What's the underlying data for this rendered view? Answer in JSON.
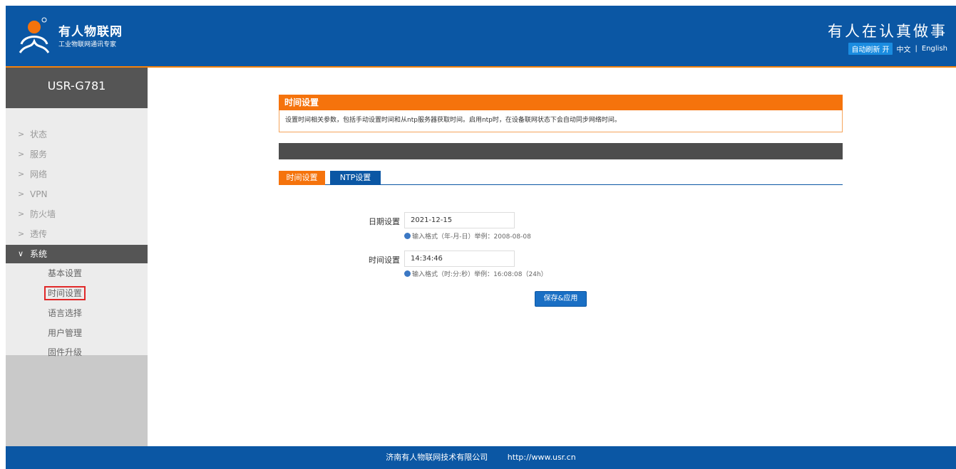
{
  "header": {
    "brand_title": "有人物联网",
    "brand_sub": "工业物联网通讯专家",
    "slogan": "有人在认真做事",
    "auto_refresh": "自动刷新 开",
    "lang_cn": "中文",
    "lang_sep": "|",
    "lang_en": "English"
  },
  "sidebar": {
    "model": "USR-G781",
    "menu": [
      {
        "label": "状态",
        "chevron": ">"
      },
      {
        "label": "服务",
        "chevron": ">"
      },
      {
        "label": "网络",
        "chevron": ">"
      },
      {
        "label": "VPN",
        "chevron": ">"
      },
      {
        "label": "防火墙",
        "chevron": ">"
      },
      {
        "label": "透传",
        "chevron": ">"
      },
      {
        "label": "系统",
        "chevron": "∨"
      }
    ],
    "submenu": [
      "基本设置",
      "时间设置",
      "语言选择",
      "用户管理",
      "固件升级"
    ]
  },
  "main": {
    "panel_title": "时间设置",
    "panel_desc": "设置时间相关参数，包括手动设置时间和从ntp服务器获取时间。启用ntp时，在设备联网状态下会自动同步网络时间。",
    "tabs": [
      "时间设置",
      "NTP设置"
    ],
    "date_label": "日期设置",
    "date_value": "2021-12-15",
    "date_hint": "输入格式（年-月-日）举例：2008-08-08",
    "time_label": "时间设置",
    "time_value": "14:34:46",
    "time_hint": "输入格式（时:分:秒）举例：16:08:08（24h）",
    "save_button": "保存&应用"
  },
  "footer": {
    "company": "济南有人物联网技术有限公司",
    "url": "http://www.usr.cn"
  },
  "colors": {
    "header_blue": "#0b57a4",
    "accent_orange": "#f5730c",
    "sidebar_dark": "#555555"
  }
}
